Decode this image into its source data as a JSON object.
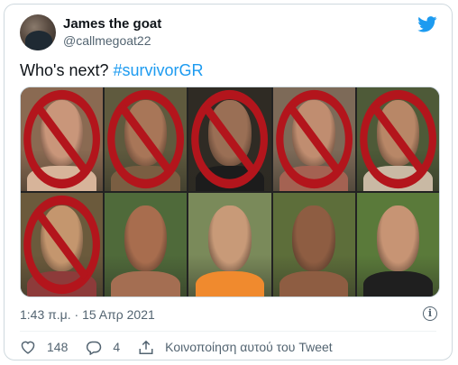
{
  "header": {
    "display_name": "James the goat",
    "handle": "@callmegoat22"
  },
  "tweet": {
    "text": "Who's next?",
    "hashtag": "#survivorGR"
  },
  "media": {
    "tiles": [
      {
        "bg": "#8a6a52",
        "skin": "#c9967a",
        "shirt": "#d7b49a",
        "banned": true
      },
      {
        "bg": "#5f5a3e",
        "skin": "#a87658",
        "shirt": "#7a5e42",
        "banned": true
      },
      {
        "bg": "#2f2b24",
        "skin": "#9a6f55",
        "shirt": "#1c1c1c",
        "banned": true
      },
      {
        "bg": "#7d6a58",
        "skin": "#c08d70",
        "shirt": "#a46252",
        "banned": true
      },
      {
        "bg": "#4e5a38",
        "skin": "#b88767",
        "shirt": "#c9b9a4",
        "banned": true
      },
      {
        "bg": "#6b5a3c",
        "skin": "#c4966e",
        "shirt": "#8d3b3a",
        "banned": true
      },
      {
        "bg": "#4f6a3a",
        "skin": "#a86d4e",
        "shirt": "#a46e52",
        "banned": false
      },
      {
        "bg": "#7a8a5a",
        "skin": "#c89a78",
        "shirt": "#f08a2e",
        "banned": false
      },
      {
        "bg": "#5d6e3a",
        "skin": "#8e5d42",
        "shirt": "#8e5d42",
        "banned": false
      },
      {
        "bg": "#5a7a3a",
        "skin": "#c79474",
        "shirt": "#1f1f1f",
        "banned": false
      }
    ]
  },
  "timestamp": "1:43 π.μ. · 15 Απρ 2021",
  "actions": {
    "likes": "148",
    "replies": "4",
    "share_label": "Κοινοποίηση αυτού του Tweet"
  },
  "colors": {
    "accent": "#1d9bf0",
    "ban_red": "#b3151c",
    "muted": "#536471"
  },
  "icons": [
    "twitter-bird-icon",
    "info-icon",
    "heart-icon",
    "reply-icon",
    "share-icon"
  ]
}
